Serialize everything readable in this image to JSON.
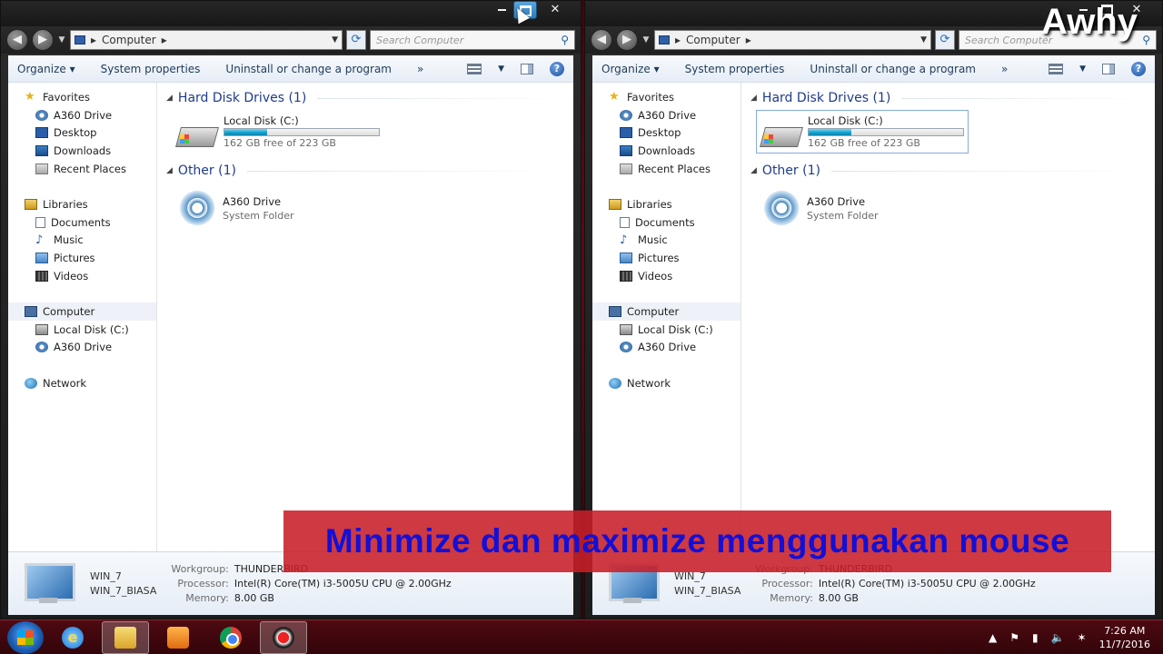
{
  "watermark": "Awhy",
  "caption": "Minimize dan maximize menggunakan mouse",
  "windows": [
    {
      "address": "Computer",
      "search_placeholder": "Search Computer",
      "toolbar": {
        "organize": "Organize",
        "system_properties": "System properties",
        "uninstall": "Uninstall or change a program",
        "more": "»"
      },
      "nav": {
        "favorites": "Favorites",
        "a360": "A360 Drive",
        "desktop": "Desktop",
        "downloads": "Downloads",
        "recent": "Recent Places",
        "libraries": "Libraries",
        "documents": "Documents",
        "music": "Music",
        "pictures": "Pictures",
        "videos": "Videos",
        "computer": "Computer",
        "local_disk": "Local Disk (C:)",
        "a360_2": "A360 Drive",
        "network": "Network"
      },
      "groups": {
        "hdd": "Hard Disk Drives (1)",
        "other": "Other (1)"
      },
      "drive": {
        "name": "Local Disk (C:)",
        "free": "162 GB free of 223 GB",
        "used_fraction": 0.274
      },
      "other_item": {
        "name": "A360 Drive",
        "type": "System Folder"
      },
      "details": {
        "name": "WIN_7",
        "description": "WIN_7_BIASA",
        "workgroup_label": "Workgroup:",
        "workgroup": "THUNDERBIRD",
        "processor_label": "Processor:",
        "processor": "Intel(R) Core(TM) i3-5005U CPU @ 2.00GHz",
        "memory_label": "Memory:",
        "memory": "8.00 GB"
      }
    },
    {
      "address": "Computer",
      "search_placeholder": "Search Computer",
      "toolbar": {
        "organize": "Organize",
        "system_properties": "System properties",
        "uninstall": "Uninstall or change a program",
        "more": "»"
      },
      "nav": {
        "favorites": "Favorites",
        "a360": "A360 Drive",
        "desktop": "Desktop",
        "downloads": "Downloads",
        "recent": "Recent Places",
        "libraries": "Libraries",
        "documents": "Documents",
        "music": "Music",
        "pictures": "Pictures",
        "videos": "Videos",
        "computer": "Computer",
        "local_disk": "Local Disk (C:)",
        "a360_2": "A360 Drive",
        "network": "Network"
      },
      "groups": {
        "hdd": "Hard Disk Drives (1)",
        "other": "Other (1)"
      },
      "drive": {
        "name": "Local Disk (C:)",
        "free": "162 GB free of 223 GB",
        "used_fraction": 0.274
      },
      "other_item": {
        "name": "A360 Drive",
        "type": "System Folder"
      },
      "details": {
        "name": "WIN_7",
        "description": "WIN_7_BIASA",
        "workgroup_label": "Workgroup:",
        "workgroup": "THUNDERBIRD",
        "processor_label": "Processor:",
        "processor": "Intel(R) Core(TM) i3-5005U CPU @ 2.00GHz",
        "memory_label": "Memory:",
        "memory": "8.00 GB"
      }
    }
  ],
  "taskbar": {
    "apps": [
      "internet-explorer",
      "windows-explorer",
      "media-player",
      "chrome",
      "screen-recorder"
    ],
    "clock_time": "7:26 AM",
    "clock_date": "11/7/2016"
  }
}
